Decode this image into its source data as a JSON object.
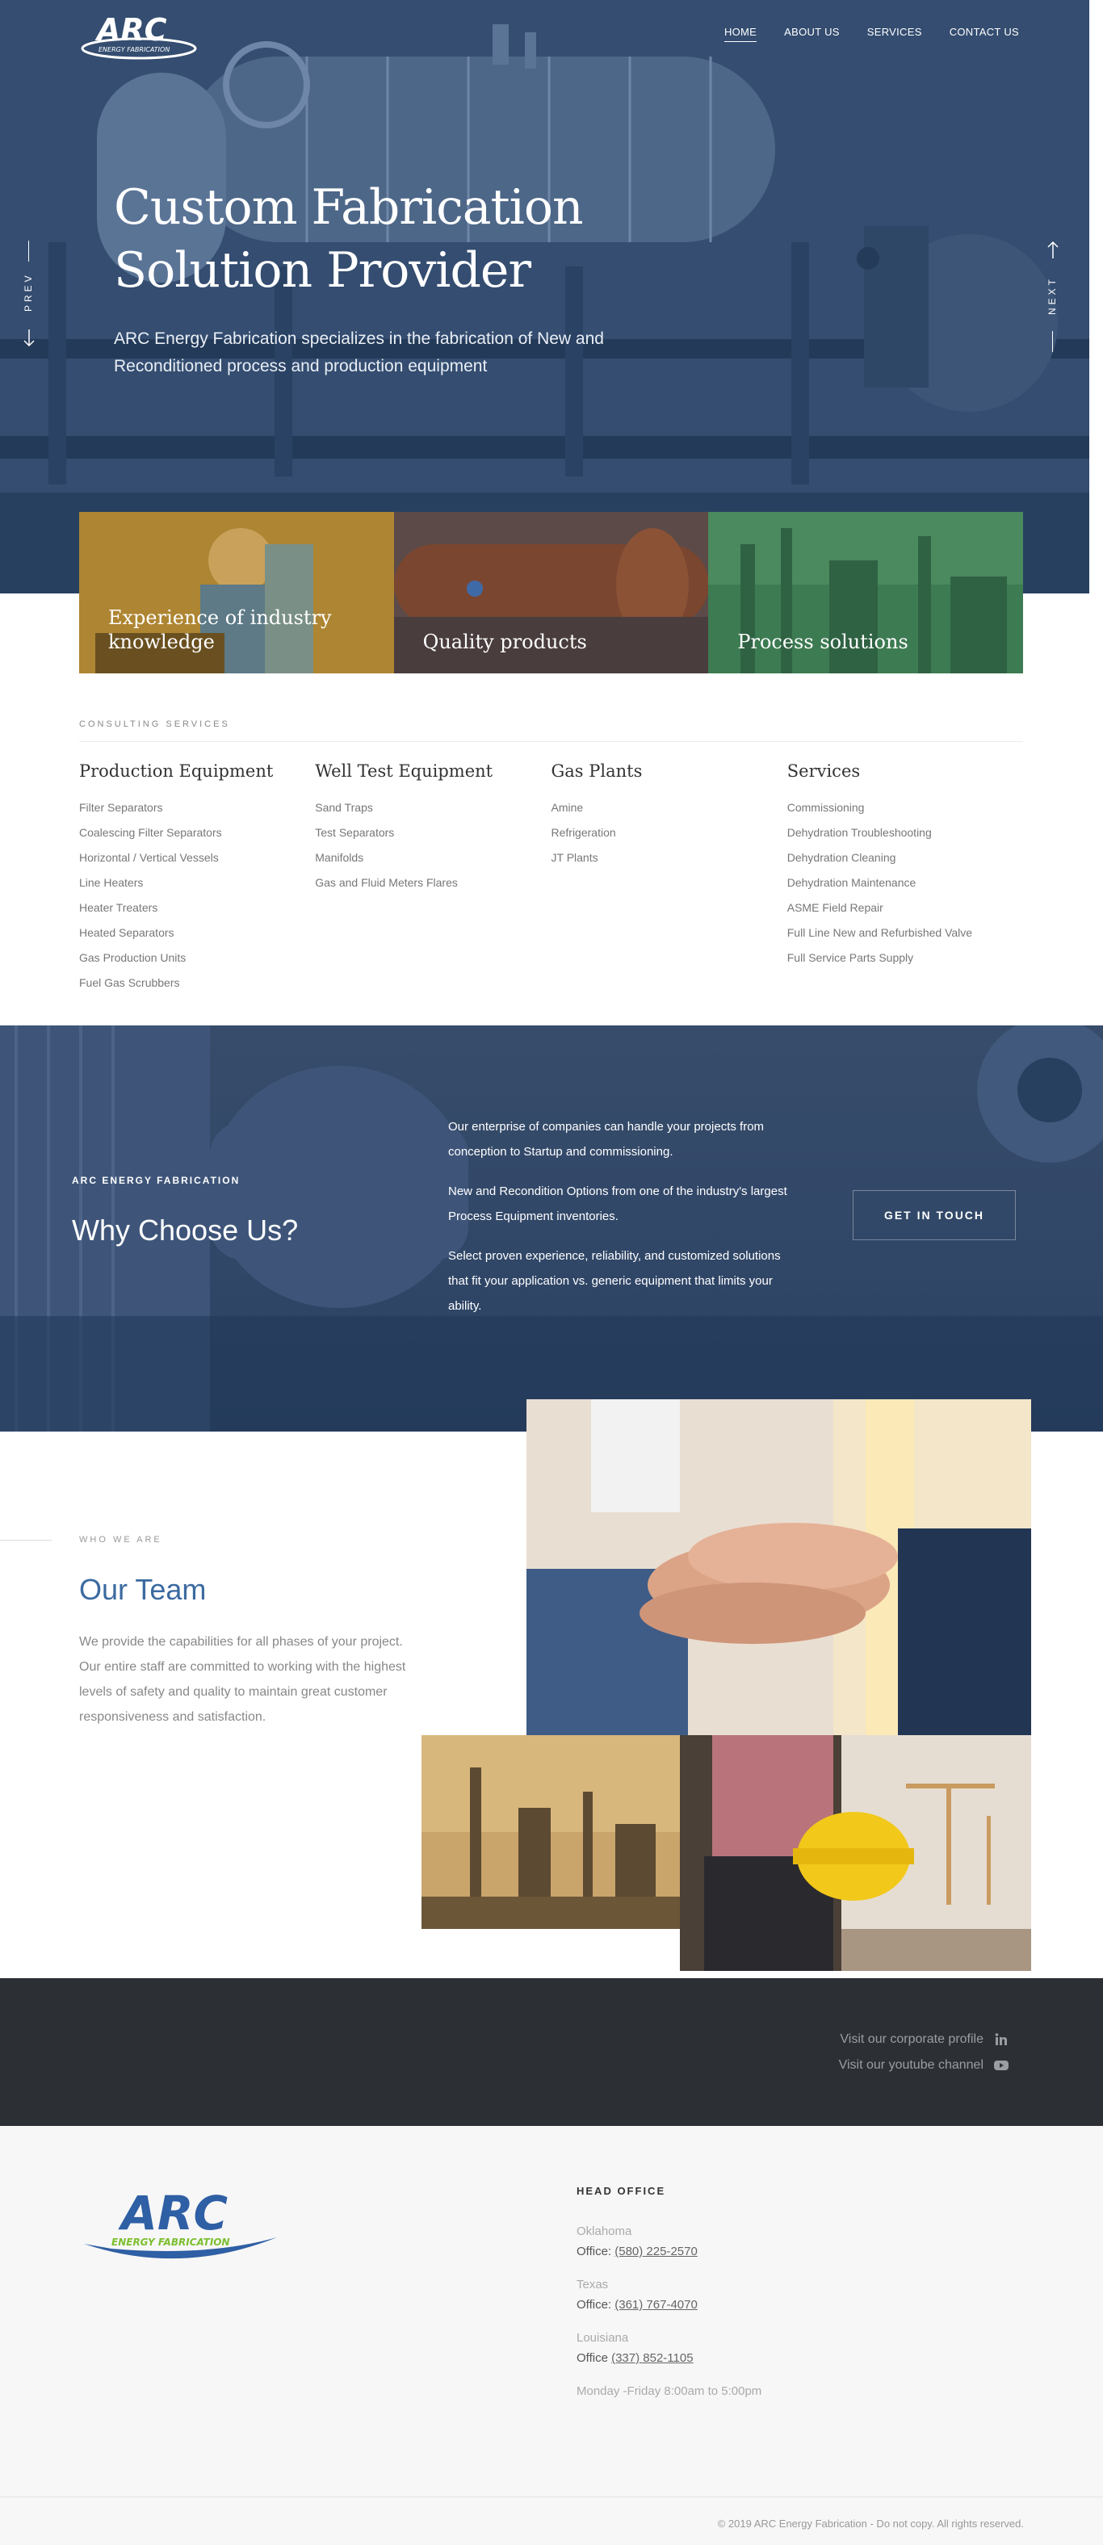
{
  "brand": {
    "logo_text": "ARC",
    "logo_sub": "ENERGY FABRICATION",
    "accent": "#2f5fa4",
    "green": "#7cbf2f"
  },
  "nav": {
    "items": [
      {
        "label": "HOME",
        "active": true
      },
      {
        "label": "ABOUT US"
      },
      {
        "label": "SERVICES"
      },
      {
        "label": "CONTACT US"
      }
    ]
  },
  "hero": {
    "title": "Custom Fabrication Solution Provider",
    "subtitle": "ARC Energy Fabrication specializes in the fabrication of New and Reconditioned process and production equipment",
    "prev_label": "PREV",
    "next_label": "NEXT"
  },
  "features": [
    {
      "label": "Experience of industry knowledge",
      "tint": "#b58a2a"
    },
    {
      "label": "Quality products",
      "tint": "#7a4a2a"
    },
    {
      "label": "Process solutions",
      "tint": "#3f7a50"
    }
  ],
  "consulting": {
    "eyebrow": "CONSULTING SERVICES",
    "columns": [
      {
        "title": "Production Equipment",
        "items": [
          "Filter Separators",
          "Coalescing Filter Separators",
          "Horizontal / Vertical Vessels",
          "Line Heaters",
          "Heater Treaters",
          "Heated Separators",
          "Gas Production Units",
          "Fuel Gas Scrubbers"
        ]
      },
      {
        "title": "Well Test Equipment",
        "items": [
          "Sand Traps",
          "Test Separators",
          "Manifolds",
          "Gas and Fluid Meters Flares"
        ]
      },
      {
        "title": "Gas Plants",
        "items": [
          "Amine",
          "Refrigeration",
          "JT Plants"
        ]
      },
      {
        "title": "Services",
        "items": [
          "Commissioning",
          "Dehydration Troubleshooting",
          "Dehydration Cleaning",
          "Dehydration Maintenance",
          "ASME Field Repair",
          "Full Line New and Refurbished Valve",
          "Full Service Parts Supply"
        ]
      }
    ]
  },
  "why": {
    "eyebrow": "ARC ENERGY FABRICATION",
    "title": "Why Choose Us?",
    "paragraphs": [
      "Our enterprise of companies can handle your projects from conception to Startup and commissioning.",
      "New and Recondition Options from one of the industry's largest Process Equipment inventories.",
      "Select proven experience, reliability, and customized solutions that fit your application vs. generic equipment that limits your ability."
    ],
    "button": "GET IN TOUCH"
  },
  "team": {
    "eyebrow": "WHO WE ARE",
    "title": "Our Team",
    "text": "We provide the capabilities for all phases of your project. Our entire staff are committed to working with the highest levels of safety and quality to maintain great customer responsiveness and satisfaction."
  },
  "social": {
    "linkedin": "Visit our corporate profile",
    "youtube": "Visit our youtube channel"
  },
  "footer": {
    "head_office": "HEAD OFFICE",
    "offices": [
      {
        "region": "Oklahoma",
        "prefix": "Office: ",
        "phone": "(580) 225-2570"
      },
      {
        "region": "Texas",
        "prefix": "Office: ",
        "phone": "(361) 767-4070"
      },
      {
        "region": "Louisiana",
        "prefix": "Office ",
        "phone": "(337) 852-1105"
      }
    ],
    "hours": "Monday -Friday 8:00am to 5:00pm",
    "copyright": "© 2019 ARC Energy Fabrication - Do not copy. All rights reserved."
  }
}
